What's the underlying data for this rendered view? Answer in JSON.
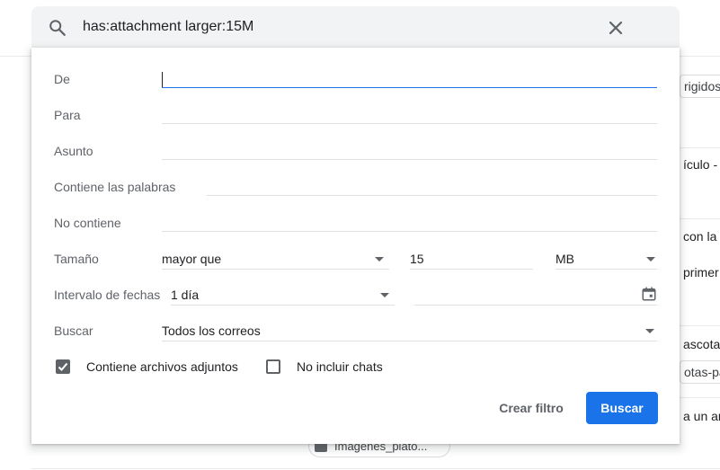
{
  "search": {
    "query": "has:attachment larger:15M"
  },
  "background": {
    "snippets": [
      "rigidos",
      "ículo - P",
      "con la",
      "primer",
      "ascotas",
      "otas-pai",
      "a un art"
    ],
    "chip_label": "Imagenes_plato..."
  },
  "form": {
    "from_label": "De",
    "to_label": "Para",
    "subject_label": "Asunto",
    "has_words_label": "Contiene las palabras",
    "doesnt_have_label": "No contiene",
    "size_label": "Tamaño",
    "size_operator": "mayor que",
    "size_value": "15",
    "size_unit": "MB",
    "date_range_label": "Intervalo de fechas",
    "date_range_value": "1 día",
    "search_in_label": "Buscar",
    "search_in_value": "Todos los correos",
    "has_attachment_label": "Contiene archivos adjuntos",
    "has_attachment_checked": true,
    "exclude_chats_label": "No incluir chats",
    "exclude_chats_checked": false
  },
  "actions": {
    "create_filter": "Crear filtro",
    "search": "Buscar"
  },
  "colors": {
    "primary": "#1a73e8",
    "label": "#5f6368",
    "searchbar_bg": "#f1f3f4"
  }
}
